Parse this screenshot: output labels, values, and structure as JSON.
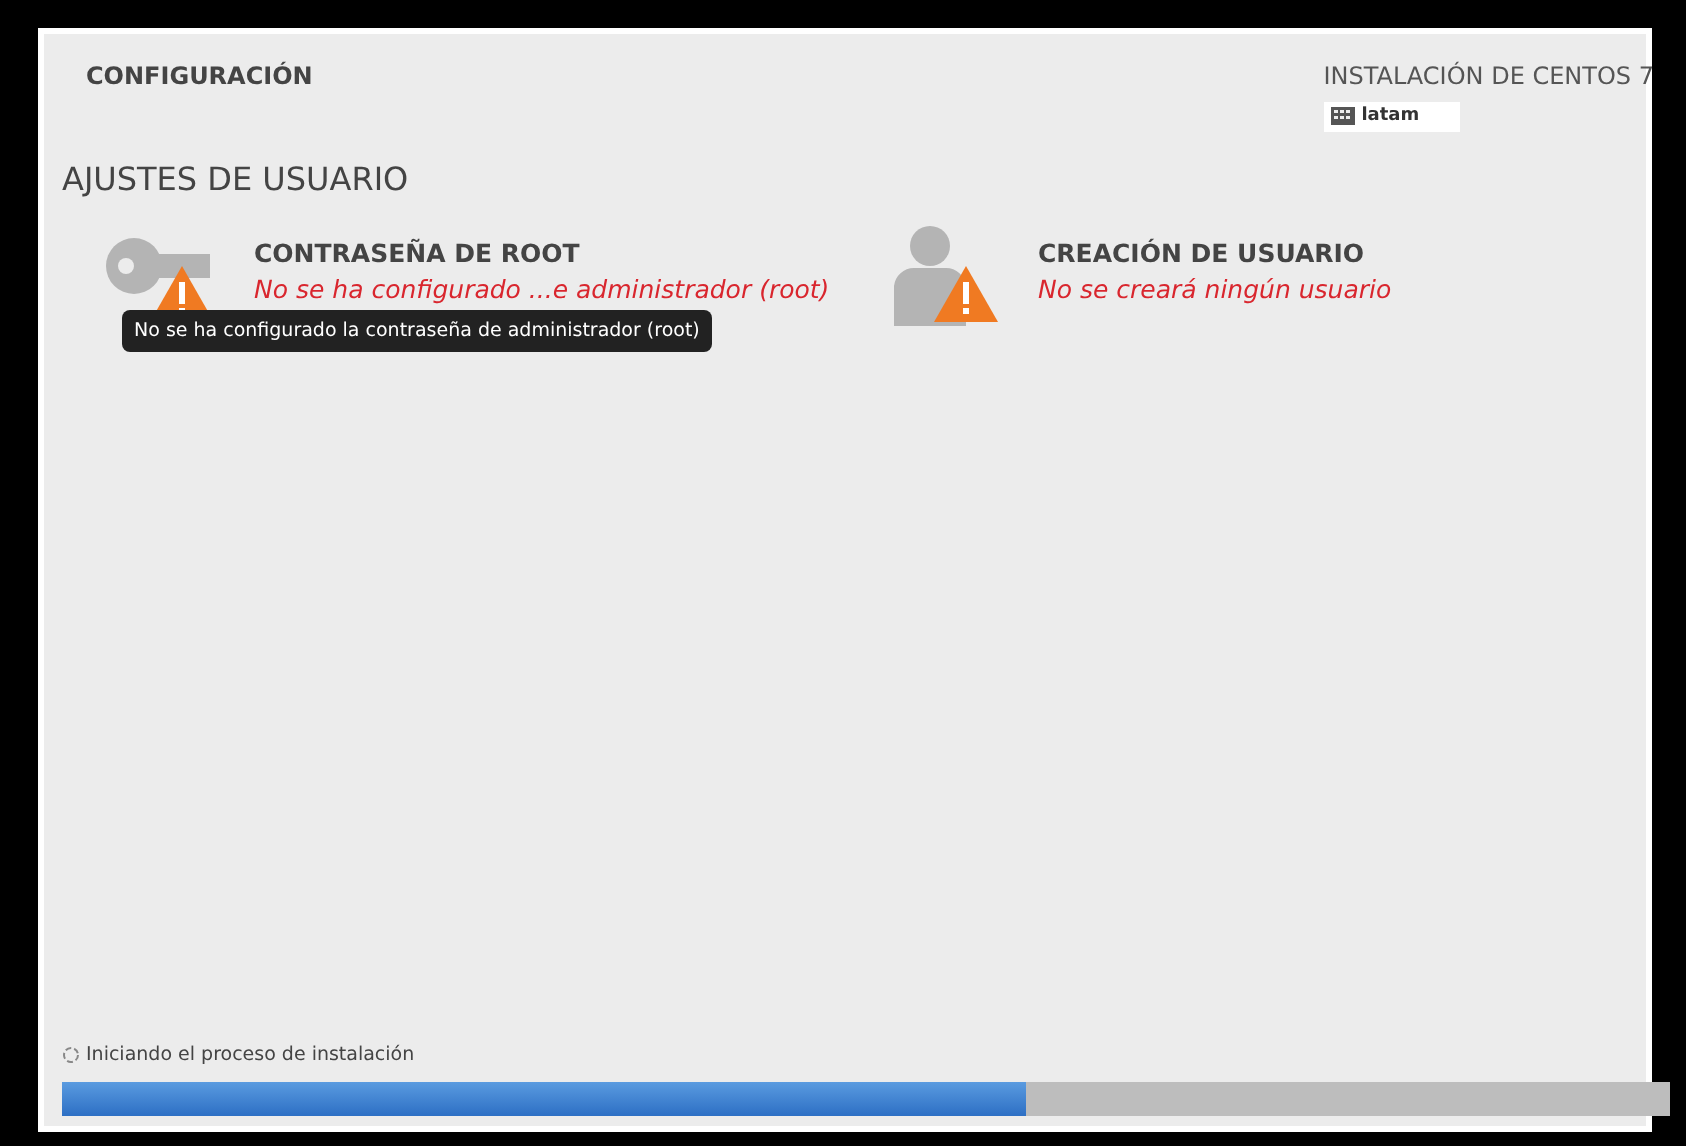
{
  "header": {
    "title": "CONFIGURACIÓN",
    "product": "INSTALACIÓN DE CENTOS 7",
    "keyboard": "latam"
  },
  "section": {
    "title": "AJUSTES DE USUARIO"
  },
  "spokes": [
    {
      "kind": "key",
      "title": "CONTRASEÑA DE ROOT",
      "status": "No se ha configurado ...e administrador (root)",
      "warning": true
    },
    {
      "kind": "user",
      "title": "CREACIÓN DE USUARIO",
      "status": "No se creará ningún usuario",
      "warning": true
    }
  ],
  "tooltip": "No se ha configurado la contraseña de administrador (root)",
  "status_bar": {
    "text": "Iniciando el proceso de instalación",
    "level": 0.6
  }
}
